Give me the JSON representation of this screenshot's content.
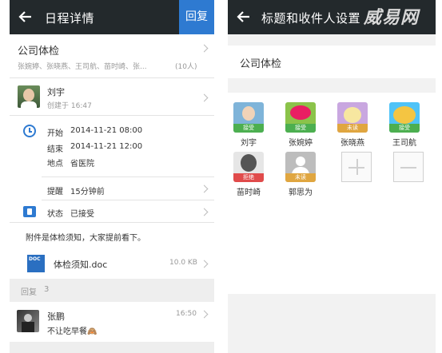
{
  "left": {
    "header": {
      "title": "日程详情",
      "reply_button": "回复"
    },
    "event": {
      "title": "公司体检",
      "attendees": "张婉婷、张晓燕、王司航、苗时崎、张...",
      "attendee_count": "(10人)"
    },
    "creator": {
      "name": "刘宇",
      "created": "创建于 16:47"
    },
    "details": {
      "start_label": "开始",
      "start_value": "2014-11-21 08:00",
      "end_label": "结束",
      "end_value": "2014-11-21 12:00",
      "location_label": "地点",
      "location_value": "省医院",
      "reminder_label": "提醒",
      "reminder_value": "15分钟前",
      "status_label": "状态",
      "status_value": "已接受"
    },
    "note": "附件是体检须知，大家提前看下。",
    "attachment": {
      "icon_text": "DOC",
      "name": "体检须知.doc",
      "size": "10.0 KB"
    },
    "replies": {
      "label": "回复",
      "count": "3"
    },
    "reply_item": {
      "author": "张鹏",
      "time": "16:50",
      "text": "不让吃早餐🙈"
    }
  },
  "right": {
    "header": {
      "title": "标题和收件人设置"
    },
    "watermark": "威易网",
    "subject": "公司体检",
    "members": [
      {
        "name": "刘宇",
        "status": "接受",
        "status_type": "accepted",
        "color": "#7fb4d9"
      },
      {
        "name": "张婉婷",
        "status": "接受",
        "status_type": "accepted",
        "color": "#8bc34a"
      },
      {
        "name": "张晓燕",
        "status": "未读",
        "status_type": "unread",
        "color": "#c9a7e0"
      },
      {
        "name": "王司航",
        "status": "接受",
        "status_type": "accepted",
        "color": "#f4c542"
      },
      {
        "name": "苗时崎",
        "status": "拒绝",
        "status_type": "rejected",
        "color": "#555555"
      },
      {
        "name": "郭思为",
        "status": "未读",
        "status_type": "unread",
        "color": "#bdbdbd"
      }
    ]
  }
}
